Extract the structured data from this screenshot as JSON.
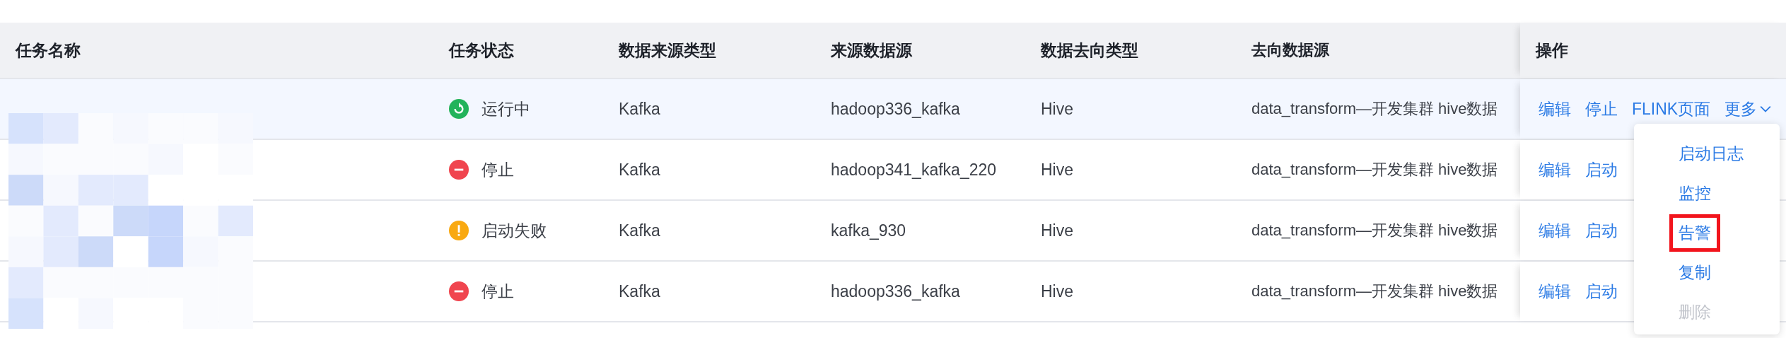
{
  "columns": [
    "任务名称",
    "任务状态",
    "数据来源类型",
    "来源数据源",
    "数据去向类型",
    "去向数据源",
    "操作"
  ],
  "rows": [
    {
      "status": {
        "kind": "running",
        "label": "运行中"
      },
      "source_type": "Kafka",
      "source": "hadoop336_kafka",
      "target_type": "Hive",
      "target": "data_transform—开发集群 hive数据",
      "actions": [
        "编辑",
        "停止",
        "FLINK页面"
      ],
      "more": "更多",
      "hovered": true
    },
    {
      "status": {
        "kind": "stopped",
        "label": "停止"
      },
      "source_type": "Kafka",
      "source": "hadoop341_kafka_220",
      "target_type": "Hive",
      "target": "data_transform—开发集群 hive数据",
      "actions": [
        "编辑",
        "启动"
      ],
      "hovered": false
    },
    {
      "status": {
        "kind": "failed",
        "label": "启动失败"
      },
      "source_type": "Kafka",
      "source": "kafka_930",
      "target_type": "Hive",
      "target": "data_transform—开发集群 hive数据",
      "actions": [
        "编辑",
        "启动"
      ],
      "hovered": false
    },
    {
      "status": {
        "kind": "stopped",
        "label": "停止"
      },
      "source_type": "Kafka",
      "source": "hadoop336_kafka",
      "target_type": "Hive",
      "target": "data_transform—开发集群 hive数据",
      "actions": [
        "编辑",
        "启动"
      ],
      "hovered": false
    }
  ],
  "more_menu": {
    "items": [
      {
        "label": "启动日志",
        "disabled": false,
        "outlined": false
      },
      {
        "label": "监控",
        "disabled": false,
        "outlined": false
      },
      {
        "label": "告警",
        "disabled": false,
        "outlined": true
      },
      {
        "label": "复制",
        "disabled": false,
        "outlined": false
      },
      {
        "label": "删除",
        "disabled": true,
        "outlined": false
      }
    ]
  }
}
